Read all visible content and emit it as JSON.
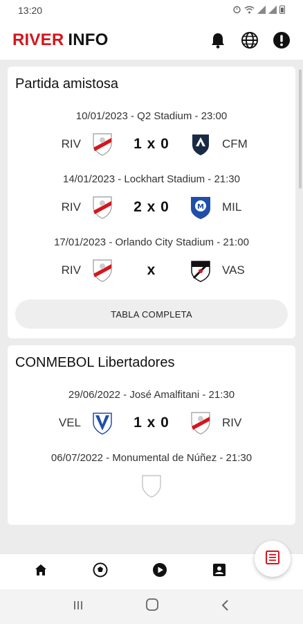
{
  "status": {
    "time": "13:20",
    "icons": [
      "alarm-icon",
      "wifi-icon",
      "signal-icon",
      "signal-icon",
      "battery-icon"
    ]
  },
  "app": {
    "title_part1": "RIVER",
    "title_part2": "INFO",
    "accent": "#d6151d",
    "actions": [
      "bell-icon",
      "globe-icon",
      "info-icon"
    ]
  },
  "sections": [
    {
      "title": "Partida amistosa",
      "matches": [
        {
          "meta": "10/01/2023 - Q2 Stadium - 23:00",
          "home": "RIV",
          "score": "1 x 0",
          "away": "CFM",
          "home_crest": "river-plate-crest",
          "away_crest": "monterrey-crest"
        },
        {
          "meta": "14/01/2023 - Lockhart Stadium - 21:30",
          "home": "RIV",
          "score": "2 x 0",
          "away": "MIL",
          "home_crest": "river-plate-crest",
          "away_crest": "millonarios-crest"
        },
        {
          "meta": "17/01/2023 - Orlando City Stadium - 21:00",
          "home": "RIV",
          "score": "x",
          "away": "VAS",
          "home_crest": "river-plate-crest",
          "away_crest": "vasco-crest"
        }
      ],
      "button": "TABLA COMPLETA"
    },
    {
      "title": "CONMEBOL Libertadores",
      "matches": [
        {
          "meta": "29/06/2022 - José Amalfitani - 21:30",
          "home": "VEL",
          "score": "1 x 0",
          "away": "RIV",
          "home_crest": "velez-crest",
          "away_crest": "river-plate-crest"
        },
        {
          "meta": "06/07/2022 - Monumental de Núñez - 21:30",
          "home": "",
          "score": "",
          "away": ""
        }
      ]
    }
  ],
  "bottom_nav": [
    "home-icon",
    "soccer-ball-icon",
    "play-icon",
    "profile-card-icon"
  ],
  "fab": "table-icon"
}
